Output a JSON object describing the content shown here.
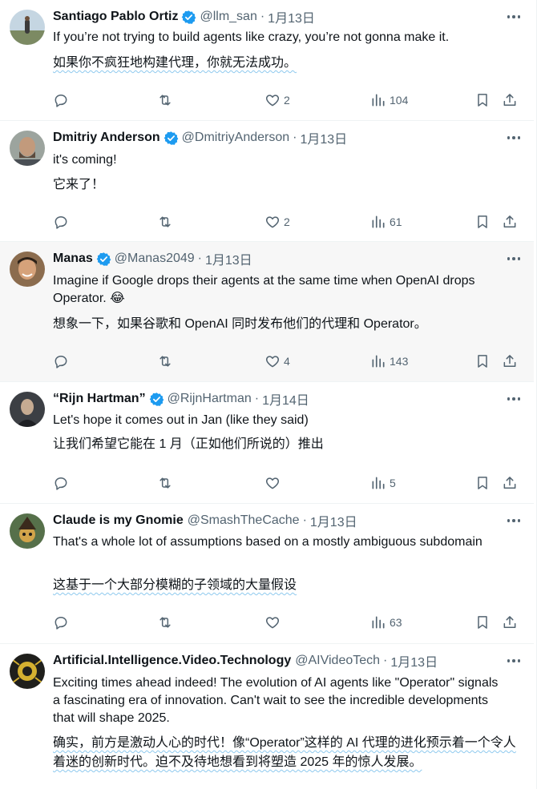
{
  "tweets": [
    {
      "name": "Santiago Pablo Ortiz",
      "handle": "@llm_san",
      "time": "1月13日",
      "text": "If you’re not trying to build agents like crazy, you’re not gonna make it.",
      "translation": "如果你不疯狂地构建代理，你就无法成功。",
      "likes": "2",
      "views": "104",
      "avatar_colors": [
        "#c3d4e0",
        "#7f8e6a"
      ]
    },
    {
      "name": "Dmitriy Anderson",
      "handle": "@DmitriyAnderson",
      "time": "1月13日",
      "text": "it's coming!",
      "translation": "它来了！",
      "likes": "2",
      "views": "61",
      "avatar_colors": [
        "#9aa39c",
        "#6b5a4a"
      ]
    },
    {
      "name": "Manas",
      "handle": "@Manas2049",
      "time": "1月13日",
      "text": "Imagine if Google drops their agents at the same time when OpenAI drops Operator. 😂",
      "translation": "想象一下，如果谷歌和 OpenAI 同时发布他们的代理和 Operator。",
      "likes": "4",
      "views": "143",
      "avatar_colors": [
        "#8a6a4c",
        "#d9a77e"
      ]
    },
    {
      "name": "“Rijn Hartman”",
      "handle": "@RijnHartman",
      "time": "1月14日",
      "text": "Let's hope it comes out in Jan (like they said)",
      "translation": "让我们希望它能在 1 月（正如他们所说的）推出",
      "likes": "",
      "views": "5",
      "avatar_colors": [
        "#3a3d42",
        "#c9b7a4"
      ]
    },
    {
      "name": "Claude is my Gnomie",
      "handle": "@SmashTheCache",
      "time": "1月13日",
      "text": "That's a whole lot of assumptions based on a mostly ambiguous subdomain",
      "translation": "这基于一个大部分模糊的子领域的大量假设",
      "likes": "",
      "views": "63",
      "avatar_colors": [
        "#5a6e4a",
        "#d8b04a"
      ]
    },
    {
      "name": "Artificial.Intelligence.Video.Technology",
      "handle": "@AIVideoTech",
      "time": "1月13日",
      "text": "Exciting times ahead indeed! The evolution of AI agents like \"Operator\" signals a fascinating era of innovation. Can't wait to see the incredible developments that will shape 2025.",
      "translation": "确实，前方是激动人心的时代！像“Operator”这样的 AI 代理的进化预示着一个令人着迷的创新时代。迫不及待地想看到将塑造 2025 年的惊人发展。",
      "likes": null,
      "views": null,
      "avatar_colors": [
        "#1f1f1c",
        "#d6b432"
      ]
    }
  ],
  "dot": "·",
  "colors": {
    "verified": "#1d9bf0",
    "secondary_text": "#536471",
    "primary_text": "#0f1419",
    "highlight_bg": "#f7f7f7"
  },
  "icons": [
    "reply-icon",
    "retweet-icon",
    "like-icon",
    "views-icon",
    "bookmark-icon",
    "share-icon",
    "more-icon",
    "verified-badge-icon"
  ]
}
